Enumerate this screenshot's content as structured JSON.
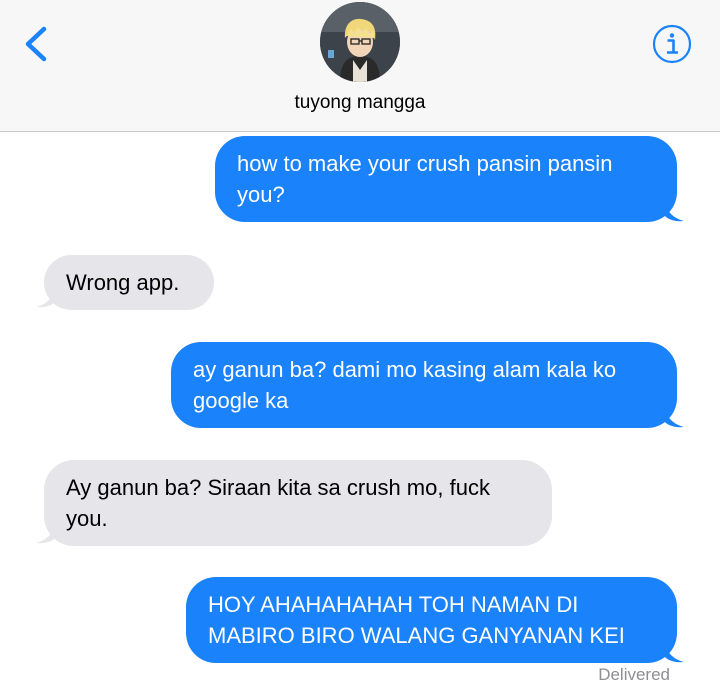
{
  "header": {
    "contact_name": "tuyong mangga",
    "back_icon": "chevron-left-icon",
    "info_icon": "info-icon",
    "accent_color": "#1a82fb"
  },
  "messages": [
    {
      "direction": "outgoing",
      "text": "how to make your crush pansin pansin you?"
    },
    {
      "direction": "incoming",
      "text": "Wrong app."
    },
    {
      "direction": "outgoing",
      "text": "ay ganun ba? dami mo kasing alam kala ko google ka"
    },
    {
      "direction": "incoming",
      "text": "Ay ganun ba? Siraan kita sa crush mo, fuck you."
    },
    {
      "direction": "outgoing",
      "text": "HOY AHAHAHAHAH TOH NAMAN DI MABIRO BIRO WALANG GANYANAN KEI"
    }
  ],
  "status": "Delivered"
}
